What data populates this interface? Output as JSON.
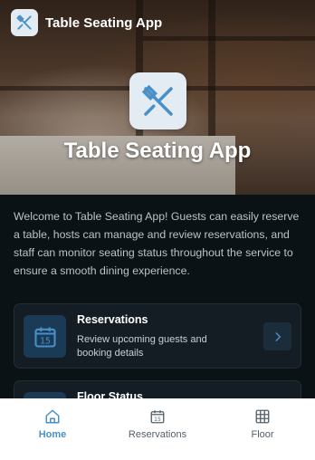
{
  "app": {
    "title": "Table Seating App"
  },
  "hero": {
    "title": "Table Seating App"
  },
  "intro": "Welcome to Table Seating App! Guests can easily reserve a table, hosts can manage and review reservations, and staff can monitor seating status throughout the service to ensure a smooth dining experience.",
  "cards": [
    {
      "title": "Reservations",
      "description": "Review upcoming guests and booking details",
      "icon": "calendar-icon"
    },
    {
      "title": "Floor Status",
      "description": "",
      "icon": "calendar-icon"
    }
  ],
  "tabs": [
    {
      "label": "Home",
      "icon": "home-icon",
      "active": true
    },
    {
      "label": "Reservations",
      "icon": "calendar-icon",
      "active": false
    },
    {
      "label": "Floor",
      "icon": "grid-icon",
      "active": false
    }
  ],
  "colors": {
    "accent": "#4a90c8",
    "content_bg": "#0b1216",
    "card_bg": "#141d23",
    "logo_bg": "#e3ecf3"
  }
}
